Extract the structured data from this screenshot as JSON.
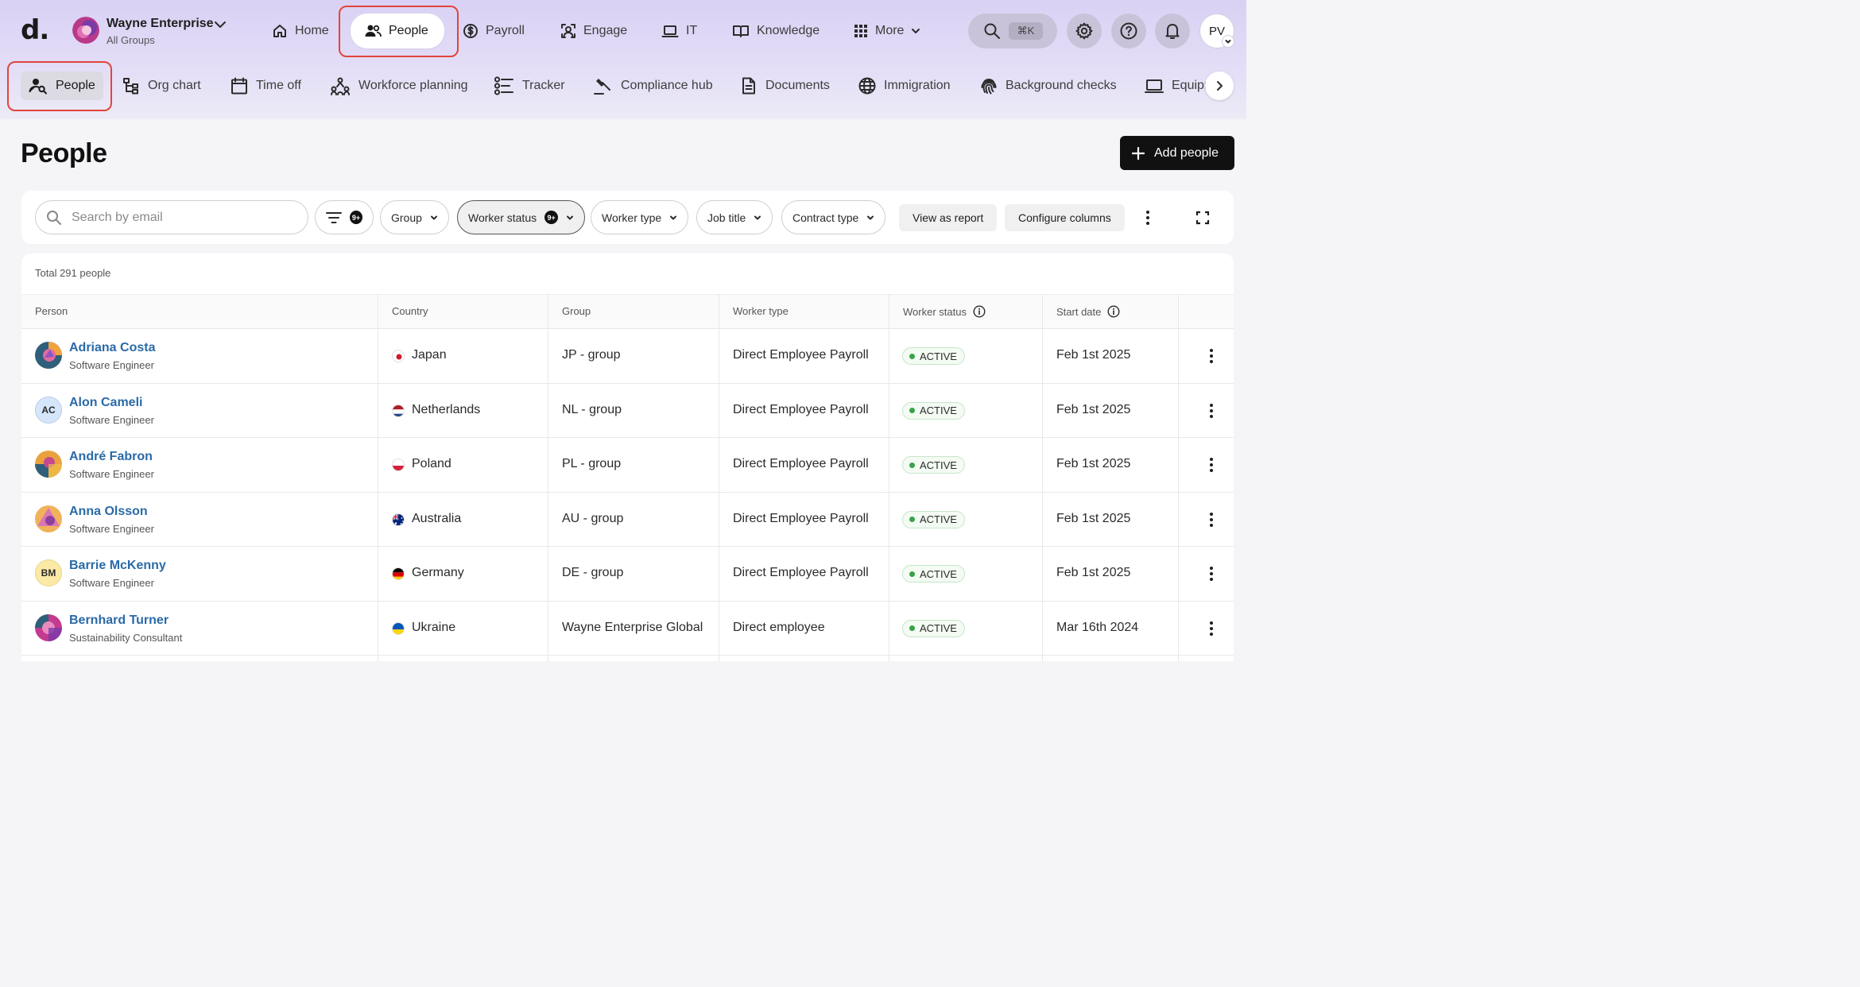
{
  "app": {
    "logo": "d."
  },
  "org": {
    "name": "Wayne Enterprise",
    "sub": "All Groups"
  },
  "nav": {
    "home": "Home",
    "people": "People",
    "payroll": "Payroll",
    "engage": "Engage",
    "it": "IT",
    "knowledge": "Knowledge",
    "more": "More",
    "shortcut": "⌘K",
    "user_initials": "PV"
  },
  "subnav": {
    "people": "People",
    "org_chart": "Org chart",
    "time_off": "Time off",
    "workforce_planning": "Workforce planning",
    "tracker": "Tracker",
    "compliance_hub": "Compliance hub",
    "documents": "Documents",
    "immigration": "Immigration",
    "background_checks": "Background checks",
    "equipment": "Equipr"
  },
  "page": {
    "title": "People",
    "add_button": "Add people"
  },
  "filters": {
    "search_placeholder": "Search by email",
    "filter_count": "9+",
    "group": "Group",
    "worker_status": "Worker status",
    "worker_status_count": "9+",
    "worker_type": "Worker type",
    "job_title": "Job title",
    "contract_type": "Contract type",
    "view_report": "View as report",
    "configure_columns": "Configure columns"
  },
  "table": {
    "total": "Total 291 people",
    "headers": {
      "person": "Person",
      "country": "Country",
      "group": "Group",
      "worker_type": "Worker type",
      "worker_status": "Worker status",
      "start_date": "Start date"
    },
    "rows": [
      {
        "name": "Adriana Costa",
        "role": "Software Engineer",
        "country": "Japan",
        "group": "JP - group",
        "worker_type": "Direct Employee Payroll",
        "status": "ACTIVE",
        "start": "Feb 1st 2025"
      },
      {
        "name": "Alon Cameli",
        "initials": "AC",
        "role": "Software Engineer",
        "country": "Netherlands",
        "group": "NL - group",
        "worker_type": "Direct Employee Payroll",
        "status": "ACTIVE",
        "start": "Feb 1st 2025"
      },
      {
        "name": "André Fabron",
        "role": "Software Engineer",
        "country": "Poland",
        "group": "PL - group",
        "worker_type": "Direct Employee Payroll",
        "status": "ACTIVE",
        "start": "Feb 1st 2025"
      },
      {
        "name": "Anna Olsson",
        "role": "Software Engineer",
        "country": "Australia",
        "group": "AU - group",
        "worker_type": "Direct Employee Payroll",
        "status": "ACTIVE",
        "start": "Feb 1st 2025"
      },
      {
        "name": "Barrie McKenny",
        "initials": "BM",
        "role": "Software Engineer",
        "country": "Germany",
        "group": "DE - group",
        "worker_type": "Direct Employee Payroll",
        "status": "ACTIVE",
        "start": "Feb 1st 2025"
      },
      {
        "name": "Bernhard Turner",
        "role": "Sustainability Consultant",
        "country": "Ukraine",
        "group": "Wayne Enterprise Global",
        "worker_type": "Direct employee",
        "status": "ACTIVE",
        "start": "Mar 16th 2024"
      }
    ]
  },
  "colors": {
    "accent": "#2a6aa7",
    "highlight": "#e2453a",
    "status_active": "#3aa149"
  }
}
